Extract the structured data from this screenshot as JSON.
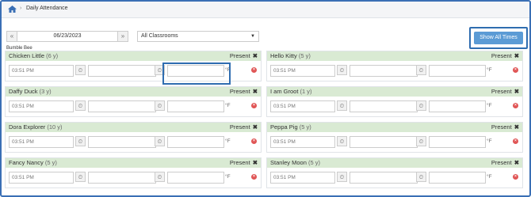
{
  "breadcrumb": {
    "home_icon": "home-icon",
    "page": "Daily Attendance"
  },
  "toolbar": {
    "date": "06/23/2023",
    "classroom": "All Classrooms",
    "show_all_label": "Show All Times"
  },
  "group_label": "Bumble Bee",
  "status_label": "Present",
  "temp_unit": "°F",
  "children": [
    {
      "name": "Chicken Little",
      "age": "(6 y)",
      "time_in": "03:51 PM"
    },
    {
      "name": "Hello Kitty",
      "age": "(5 y)",
      "time_in": "03:51 PM"
    },
    {
      "name": "Daffy Duck",
      "age": "(3 y)",
      "time_in": "03:51 PM"
    },
    {
      "name": "I am Groot",
      "age": "(1 y)",
      "time_in": "03:51 PM"
    },
    {
      "name": "Dora Explorer",
      "age": "(10 y)",
      "time_in": "03:51 PM"
    },
    {
      "name": "Peppa Pig",
      "age": "(5 y)",
      "time_in": "03:51 PM"
    },
    {
      "name": "Fancy Nancy",
      "age": "(5 y)",
      "time_in": "03:51 PM"
    },
    {
      "name": "Stanley Moon",
      "age": "(5 y)",
      "time_in": "03:51 PM"
    }
  ]
}
